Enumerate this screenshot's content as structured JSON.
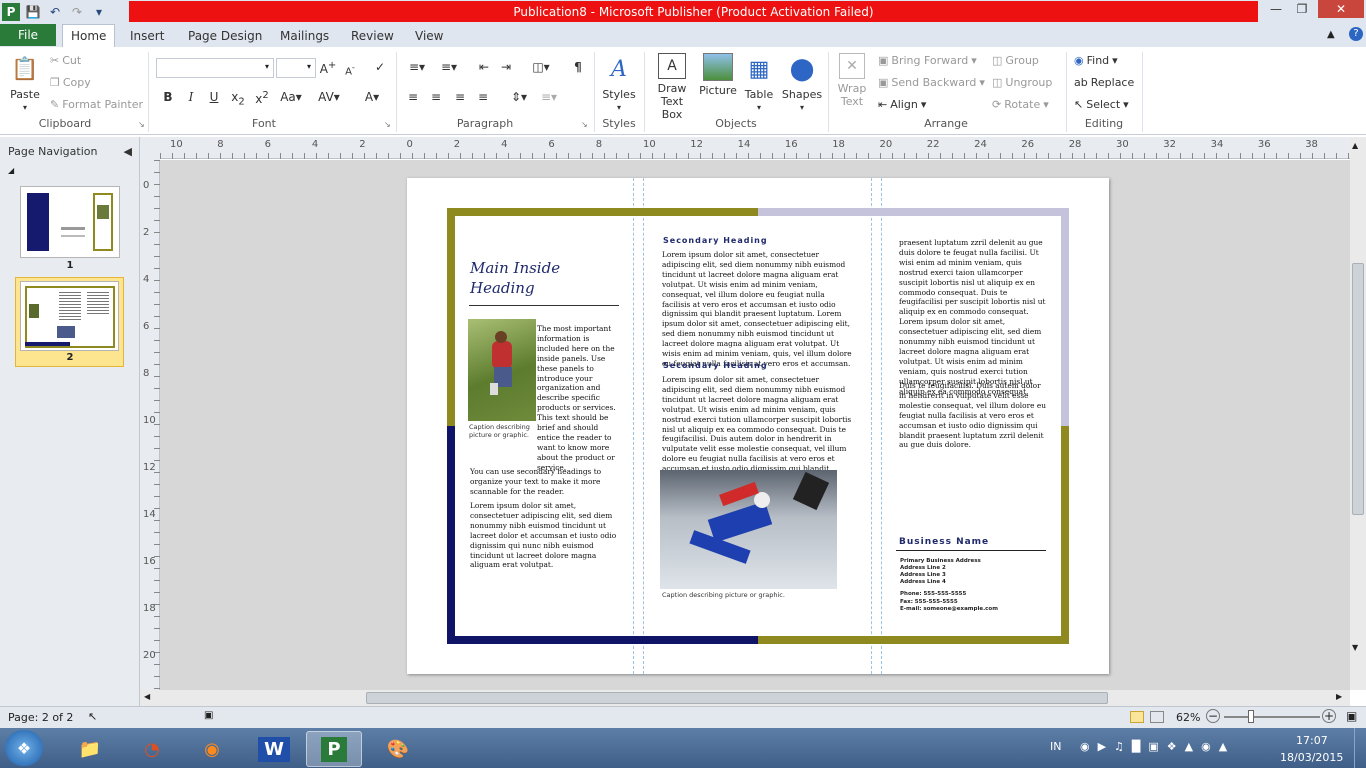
{
  "window": {
    "title": "Publication8  -  Microsoft Publisher (Product Activation Failed)"
  },
  "tabs": [
    "File",
    "Home",
    "Insert",
    "Page Design",
    "Mailings",
    "Review",
    "View"
  ],
  "active_tab": "Home",
  "clipboard": {
    "paste": "Paste",
    "cut": "Cut",
    "copy": "Copy",
    "format_painter": "Format Painter",
    "label": "Clipboard"
  },
  "font": {
    "label": "Font"
  },
  "paragraph": {
    "label": "Paragraph"
  },
  "styles": {
    "button": "Styles",
    "label": "Styles"
  },
  "objects": {
    "draw_text_box": "Draw Text Box",
    "picture": "Picture",
    "table": "Table",
    "shapes": "Shapes",
    "label": "Objects"
  },
  "arrange": {
    "wrap_text": "Wrap Text",
    "bring_forward": "Bring Forward",
    "send_backward": "Send Backward",
    "align": "Align",
    "group": "Group",
    "ungroup": "Ungroup",
    "rotate": "Rotate",
    "label": "Arrange"
  },
  "editing": {
    "find": "Find",
    "replace": "Replace",
    "select": "Select",
    "label": "Editing"
  },
  "nav": {
    "title": "Page Navigation",
    "pages": [
      "1",
      "2"
    ]
  },
  "hruler_labels": [
    "10",
    "8",
    "6",
    "4",
    "2",
    "0",
    "2",
    "4",
    "6",
    "8",
    "10",
    "12",
    "14",
    "16",
    "18",
    "20",
    "22",
    "24",
    "26",
    "28",
    "30",
    "32",
    "34",
    "36",
    "38"
  ],
  "vruler_labels": [
    "0",
    "2",
    "4",
    "6",
    "8",
    "10",
    "12",
    "14",
    "16",
    "18",
    "20"
  ],
  "doc": {
    "main_heading": "Main Inside Heading",
    "intro": "The most important information is included here on the inside panels. Use these panels to introduce your organization and describe specific products or services. This text should be brief and should entice the reader to want to know more about the product or service.",
    "caption1": "Caption describing picture or graphic.",
    "para2": "You can use secondary headings to organize your text to make it more scannable for the reader.",
    "para3": "Lorem ipsum dolor sit amet, consectetuer adipiscing elit, sed diem nonummy nibh euismod tincidunt ut lacreet dolor et accumsan et iusto odio dignissim qui nunc nibh euismod tincidunt ut lacreet dolore magna aliguam erat volutpat.",
    "sec_heading1": "Secondary Heading",
    "mid1": "Lorem ipsum dolor sit amet, consectetuer adipiscing elit, sed diem nonummy nibh euismod tincidunt ut lacreet dolore magna aliguam erat volutpat. Ut wisis enim ad minim veniam, consequat, vel illum dolore eu feugiat nulla facilisis at vero eros et accumsan et iusto odio dignissim qui blandit praesent luptatum. Lorem ipsum dolor sit amet, consectetuer adipiscing elit, sed diem nonummy nibh euismod tincidunt ut lacreet dolore magna aliguam erat volutpat. Ut wisis enim ad minim veniam, quis, vel illum dolore eu feugiat nulla facilisis at vero eros et accumsan.",
    "sec_heading2": "Secondary Heading",
    "mid2": "Lorem ipsum dolor sit amet, consectetuer adipiscing elit, sed diem nonummy nibh euismod tincidunt ut lacreet dolore magna aliguam erat volutpat. Ut wisis enim ad minim veniam, quis nostrud exerci tution ullamcorper suscipit lobortis nisl ut aliquip ex ea commodo consequat. Duis te feugifacilisi. Duis autem dolor in hendrerit in vulputate velit esse molestie consequat, vel illum dolore eu feugiat nulla facilisis at vero eros et accumsan et iusto odio dignissim qui blandit",
    "caption2": "Caption describing picture or graphic.",
    "right1": "praesent luptatum zzril delenit au gue duis dolore te feugat nulla facilisi. Ut wisi enim ad minim veniam, quis nostrud exerci taion ullamcorper suscipit lobortis nisl ut aliquip ex en commodo consequat. Duis te feugifacilisi per suscipit lobortis nisl ut aliquip ex en commodo consequat. Lorem ipsum dolor sit amet, consectetuer adipiscing elit, sed diem nonummy nibh euismod tincidunt ut lacreet dolore magna aliguam erat volutpat. Ut wisis enim ad minim veniam, quis nostrud exerci tution ullamcorper suscipit lobortis nisl ut aliquip ex ea commodo consequat.",
    "right2": "Duis te feugifacilisi. Duis autem dolor in hendrerit in vulputate velit esse molestie consequat, vel illum dolore eu feugiat nulla facilisis at vero eros et accumsan et iusto odio dignissim qui blandit praesent luptatum zzril delenit au gue duis dolore.",
    "business_name": "Business Name",
    "address": [
      "Primary Business Address",
      "Address Line 2",
      "Address Line 3",
      "Address Line 4"
    ],
    "contact": [
      "Phone: 555-555-5555",
      "Fax: 555-555-5555",
      "E-mail: someone@example.com"
    ]
  },
  "status": {
    "page": "Page: 2 of 2",
    "zoom": "62%"
  },
  "taskbar": {
    "lang": "IN",
    "time": "17:07",
    "date": "18/03/2015"
  },
  "colors": {
    "olive": "#8e8a20",
    "navy": "#0f1466",
    "lavender": "#c5c3dc",
    "title_red": "#ee1111",
    "file_green": "#2a7a3a"
  }
}
